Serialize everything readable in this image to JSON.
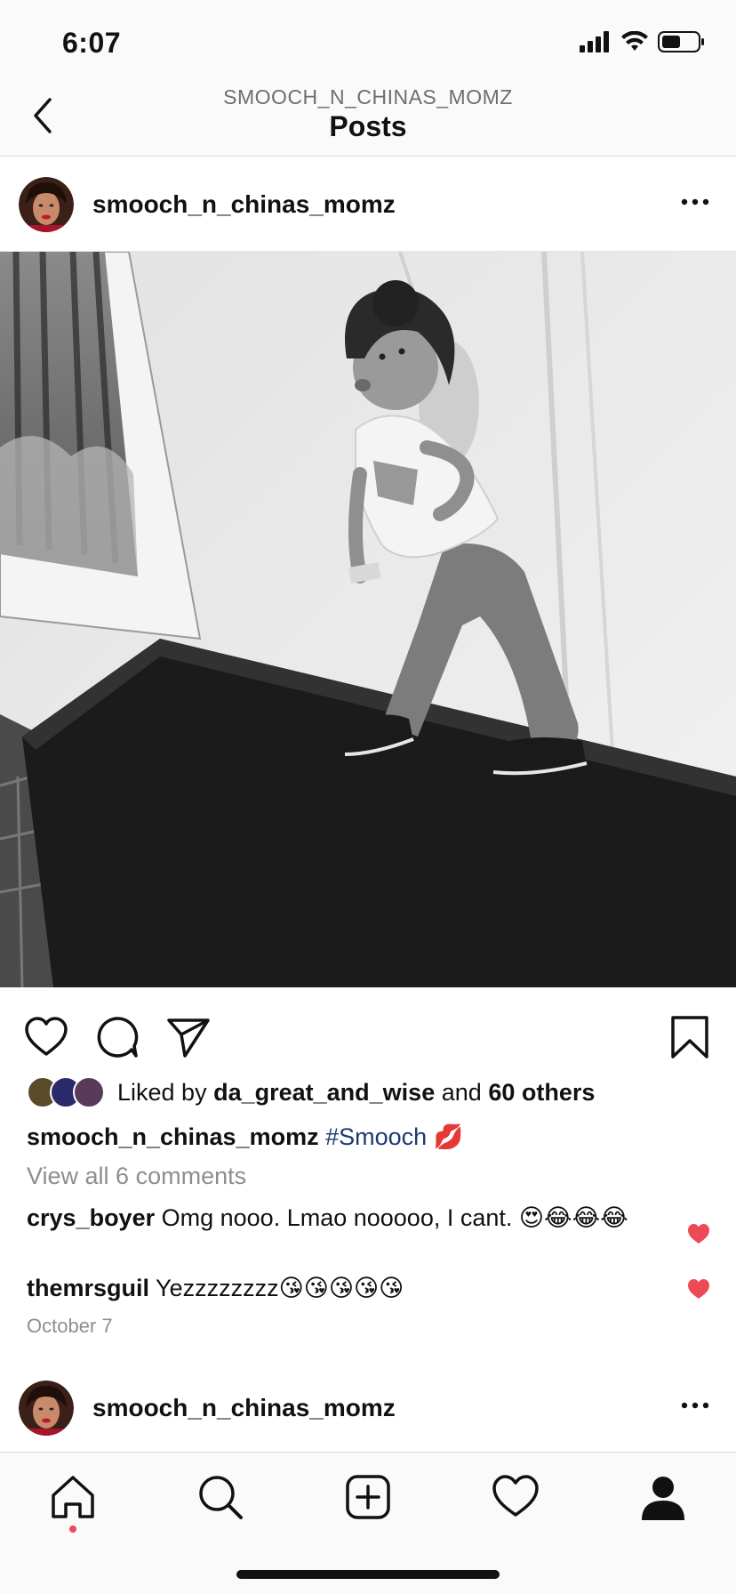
{
  "status_bar": {
    "time": "6:07"
  },
  "nav": {
    "subtitle": "SMOOCH_N_CHINAS_MOMZ",
    "title": "Posts"
  },
  "post": {
    "username": "smooch_n_chinas_momz",
    "likes": {
      "prefix": "Liked by",
      "liker": "da_great_and_wise",
      "middle": "and",
      "others": "60 others"
    },
    "caption": {
      "username": "smooch_n_chinas_momz",
      "hashtag": "#Smooch",
      "emoji": "💋"
    },
    "view_comments": "View all 6 comments",
    "comments": [
      {
        "username": "crys_boyer",
        "text": "Omg nooo. Lmao nooooo, I cant. 😍😂😂😂",
        "liked": true
      },
      {
        "username": "themrsguil",
        "text": "Yezzzzzzzz😘😘😘😘😘",
        "liked": true
      }
    ],
    "date": "October 7"
  },
  "next_post": {
    "username": "smooch_n_chinas_momz"
  },
  "colors": {
    "like_red": "#ed4956",
    "hashtag_blue": "#1e3a6e",
    "muted_gray": "#8e8e8e"
  },
  "icons": {
    "actions": [
      "heart-icon",
      "comment-icon",
      "share-icon",
      "bookmark-icon"
    ],
    "tab_bar": [
      "home-icon",
      "search-icon",
      "add-post-icon",
      "activity-heart-icon",
      "profile-icon"
    ]
  }
}
